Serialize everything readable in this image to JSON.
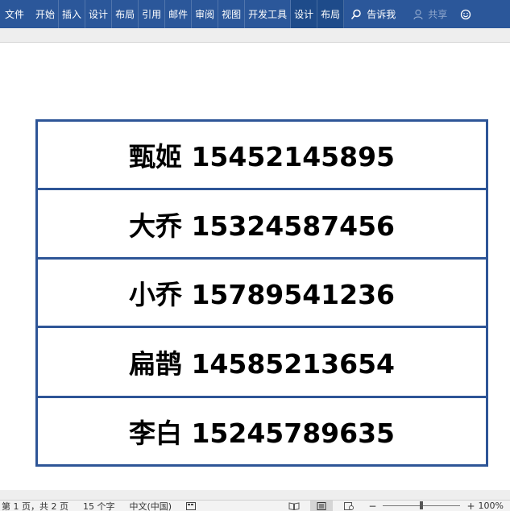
{
  "ribbon": {
    "tabs": [
      {
        "label": "文件",
        "name": "tab-file"
      },
      {
        "label": "开始",
        "name": "tab-home"
      },
      {
        "label": "插入",
        "name": "tab-insert"
      },
      {
        "label": "设计",
        "name": "tab-design"
      },
      {
        "label": "布局",
        "name": "tab-layout"
      },
      {
        "label": "引用",
        "name": "tab-references"
      },
      {
        "label": "邮件",
        "name": "tab-mailings"
      },
      {
        "label": "审阅",
        "name": "tab-review"
      },
      {
        "label": "视图",
        "name": "tab-view"
      },
      {
        "label": "开发工具",
        "name": "tab-developer"
      },
      {
        "label": "设计",
        "name": "tab-table-design"
      },
      {
        "label": "布局",
        "name": "tab-table-layout"
      }
    ],
    "tell_me": "告诉我",
    "share": "共享",
    "colors": {
      "ribbon_bg": "#2b579a",
      "table_border": "#2e5597"
    }
  },
  "document": {
    "rows": [
      "甄姬 15452145895",
      "大乔 15324587456",
      "小乔 15789541236",
      "扁鹊 14585213654",
      "李白 15245789635"
    ]
  },
  "statusbar": {
    "page": "第 1 页，共 2 页",
    "words": "15 个字",
    "language": "中文(中国)",
    "zoom": "100%"
  }
}
